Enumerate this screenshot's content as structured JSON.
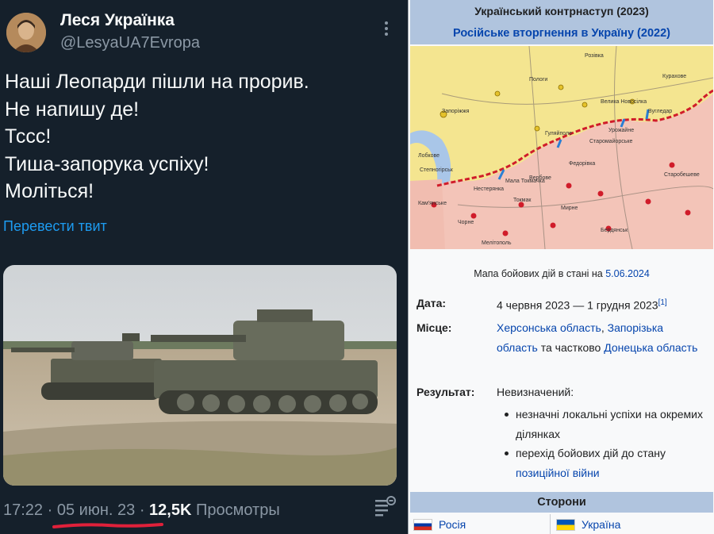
{
  "tweet": {
    "author_name": "Леся Українка",
    "author_handle": "@LesyaUA7Evropa",
    "text_lines": [
      "Наші Леопарди пішли на прорив.",
      "Не напишу де!",
      "Тссс!",
      "Тиша-запорука успіху!",
      "Моліться!"
    ],
    "translate_label": "Перевести твит",
    "time": "17:22",
    "separator": "·",
    "date": "05 июн. 23",
    "views_count": "12,5K",
    "views_label": "Просмотры",
    "icons": [
      "more-vertical-icon",
      "views-icon"
    ],
    "colors": {
      "background": "#15202b",
      "text": "#f7f9f9",
      "muted": "#8b98a5",
      "link": "#1d9bf0",
      "underline_mark": "#e0203a"
    }
  },
  "infobox": {
    "title": "Український контрнаступ (2023)",
    "parent_conflict": "Російське вторгнення в Україну (2022)",
    "map": {
      "places": [
        "Запоріжжя",
        "Лобкове",
        "Мала Токмачка",
        "Нестерянка",
        "Чорне",
        "Розівка",
        "Пологи",
        "Вербове",
        "Токмак",
        "Федорівка",
        "Велика Новосілка",
        "Старомайорське",
        "Старобешеве",
        "Урожайне",
        "Кам'янське",
        "Гуляйполе",
        "Курахове",
        "Вугледар",
        "Бердянськ",
        "Мелітополь",
        "Мирне",
        "Степногірськ"
      ]
    },
    "map_caption": "Мапа бойових дій в стані на",
    "map_caption_date": "5.06.2024",
    "date_label": "Дата:",
    "date_value": "4 червня 2023 — 1 грудня 2023",
    "date_ref": "[1]",
    "place_label": "Місце:",
    "place_links": [
      "Херсонська область",
      "Запорізька область",
      "Донецька область"
    ],
    "place_joiners": [
      ", ",
      " та частково "
    ],
    "result_label": "Результат:",
    "result_value": "Невизначений:",
    "result_bullets": [
      "незначні локальні успіхи на окремих ділянках",
      "перехід бойових дій до стану позиційної війни"
    ],
    "result_bullet2_prefix": "перехід бойових дій до стану ",
    "result_bullet2_link": "позиційної війни",
    "sides_header": "Сторони",
    "side_left": "Росія",
    "side_right": "Україна",
    "colors": {
      "header_bg": "#b0c4de",
      "link": "#0645ad",
      "text": "#202122",
      "occupied": "#f2c2b6",
      "controlled": "#f4e590"
    }
  }
}
